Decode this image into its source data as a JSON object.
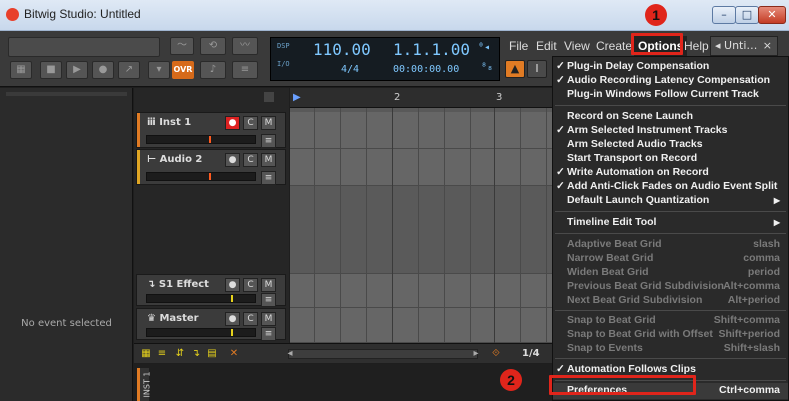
{
  "window": {
    "title": "Bitwig Studio: Untitled",
    "controls": {
      "minimize": "–",
      "maximize": "□",
      "close": "✕"
    }
  },
  "transport": {
    "ovr_label": "OVR",
    "dsp_label": "DSP",
    "io_label": "I/O",
    "tempo": "110.00",
    "time_signature": "4/4",
    "position_bars": "1.1.1.00",
    "position_time": "00:00:00.00"
  },
  "menubar": {
    "items": [
      "File",
      "Edit",
      "View",
      "Create",
      "Options",
      "Help"
    ],
    "active": "Options",
    "document_tab": "Unti…",
    "document_tab_close": "×"
  },
  "tools": {
    "pointer": "▲",
    "text": "I"
  },
  "inspector": {
    "empty_message": "No event selected"
  },
  "tracks": [
    {
      "name": "Inst 1",
      "color": "#e07b24",
      "icon": "instrument-icon",
      "meter_mark_color": "#ff5a1f"
    },
    {
      "name": "Audio 2",
      "color": "#e0a624",
      "icon": "audio-icon",
      "meter_mark_color": "#ff5a1f"
    },
    {
      "name": "S1 Effect",
      "color": "#8a8a8a",
      "icon": "effect-icon",
      "meter_mark_color": "#e6d21c"
    },
    {
      "name": "Master",
      "color": "#8a8a8a",
      "icon": "master-icon",
      "meter_mark_color": "#e6d21c"
    }
  ],
  "track_buttons": {
    "rec": "●",
    "mute": "M",
    "solo": "C",
    "menu": "≡"
  },
  "ruler": {
    "bars": [
      "2",
      "3"
    ]
  },
  "arranger_bottom": {
    "zoom": "1/4"
  },
  "device_panel": {
    "track_label": "INST 1"
  },
  "options_menu": {
    "items": [
      {
        "label": "Plug-in Delay Compensation",
        "checked": true,
        "enabled": true
      },
      {
        "label": "Audio Recording Latency Compensation",
        "checked": true,
        "enabled": true
      },
      {
        "label": "Plug-in Windows Follow Current Track",
        "checked": false,
        "enabled": true
      },
      {
        "label": "Record on Scene Launch",
        "checked": false,
        "enabled": true
      },
      {
        "label": "Arm Selected Instrument Tracks",
        "checked": true,
        "enabled": true
      },
      {
        "label": "Arm Selected Audio Tracks",
        "checked": false,
        "enabled": true
      },
      {
        "label": "Start Transport on Record",
        "checked": false,
        "enabled": true
      },
      {
        "label": "Write Automation on Record",
        "checked": true,
        "enabled": true
      },
      {
        "label": "Add Anti-Click Fades on Audio Event Split",
        "checked": true,
        "enabled": true
      },
      {
        "label": "Default Launch Quantization",
        "checked": false,
        "enabled": true,
        "submenu": true
      },
      {
        "label": "Timeline Edit Tool",
        "checked": false,
        "enabled": true,
        "submenu": true
      },
      {
        "label": "Adaptive Beat Grid",
        "shortcut": "slash",
        "enabled": false
      },
      {
        "label": "Narrow Beat Grid",
        "shortcut": "comma",
        "enabled": false
      },
      {
        "label": "Widen Beat Grid",
        "shortcut": "period",
        "enabled": false
      },
      {
        "label": "Previous Beat Grid Subdivision",
        "shortcut": "Alt+comma",
        "enabled": false
      },
      {
        "label": "Next Beat Grid Subdivision",
        "shortcut": "Alt+period",
        "enabled": false
      },
      {
        "label": "Snap to Beat Grid",
        "shortcut": "Shift+comma",
        "enabled": false
      },
      {
        "label": "Snap to Beat Grid with Offset",
        "shortcut": "Shift+period",
        "enabled": false
      },
      {
        "label": "Snap to Events",
        "shortcut": "Shift+slash",
        "enabled": false
      },
      {
        "label": "Automation Follows Clips",
        "checked": true,
        "enabled": true
      },
      {
        "label": "Preferences",
        "shortcut": "Ctrl+comma",
        "enabled": true
      }
    ]
  },
  "annotations": {
    "badge_1": "1",
    "badge_2": "2",
    "color": "#e0251b"
  }
}
